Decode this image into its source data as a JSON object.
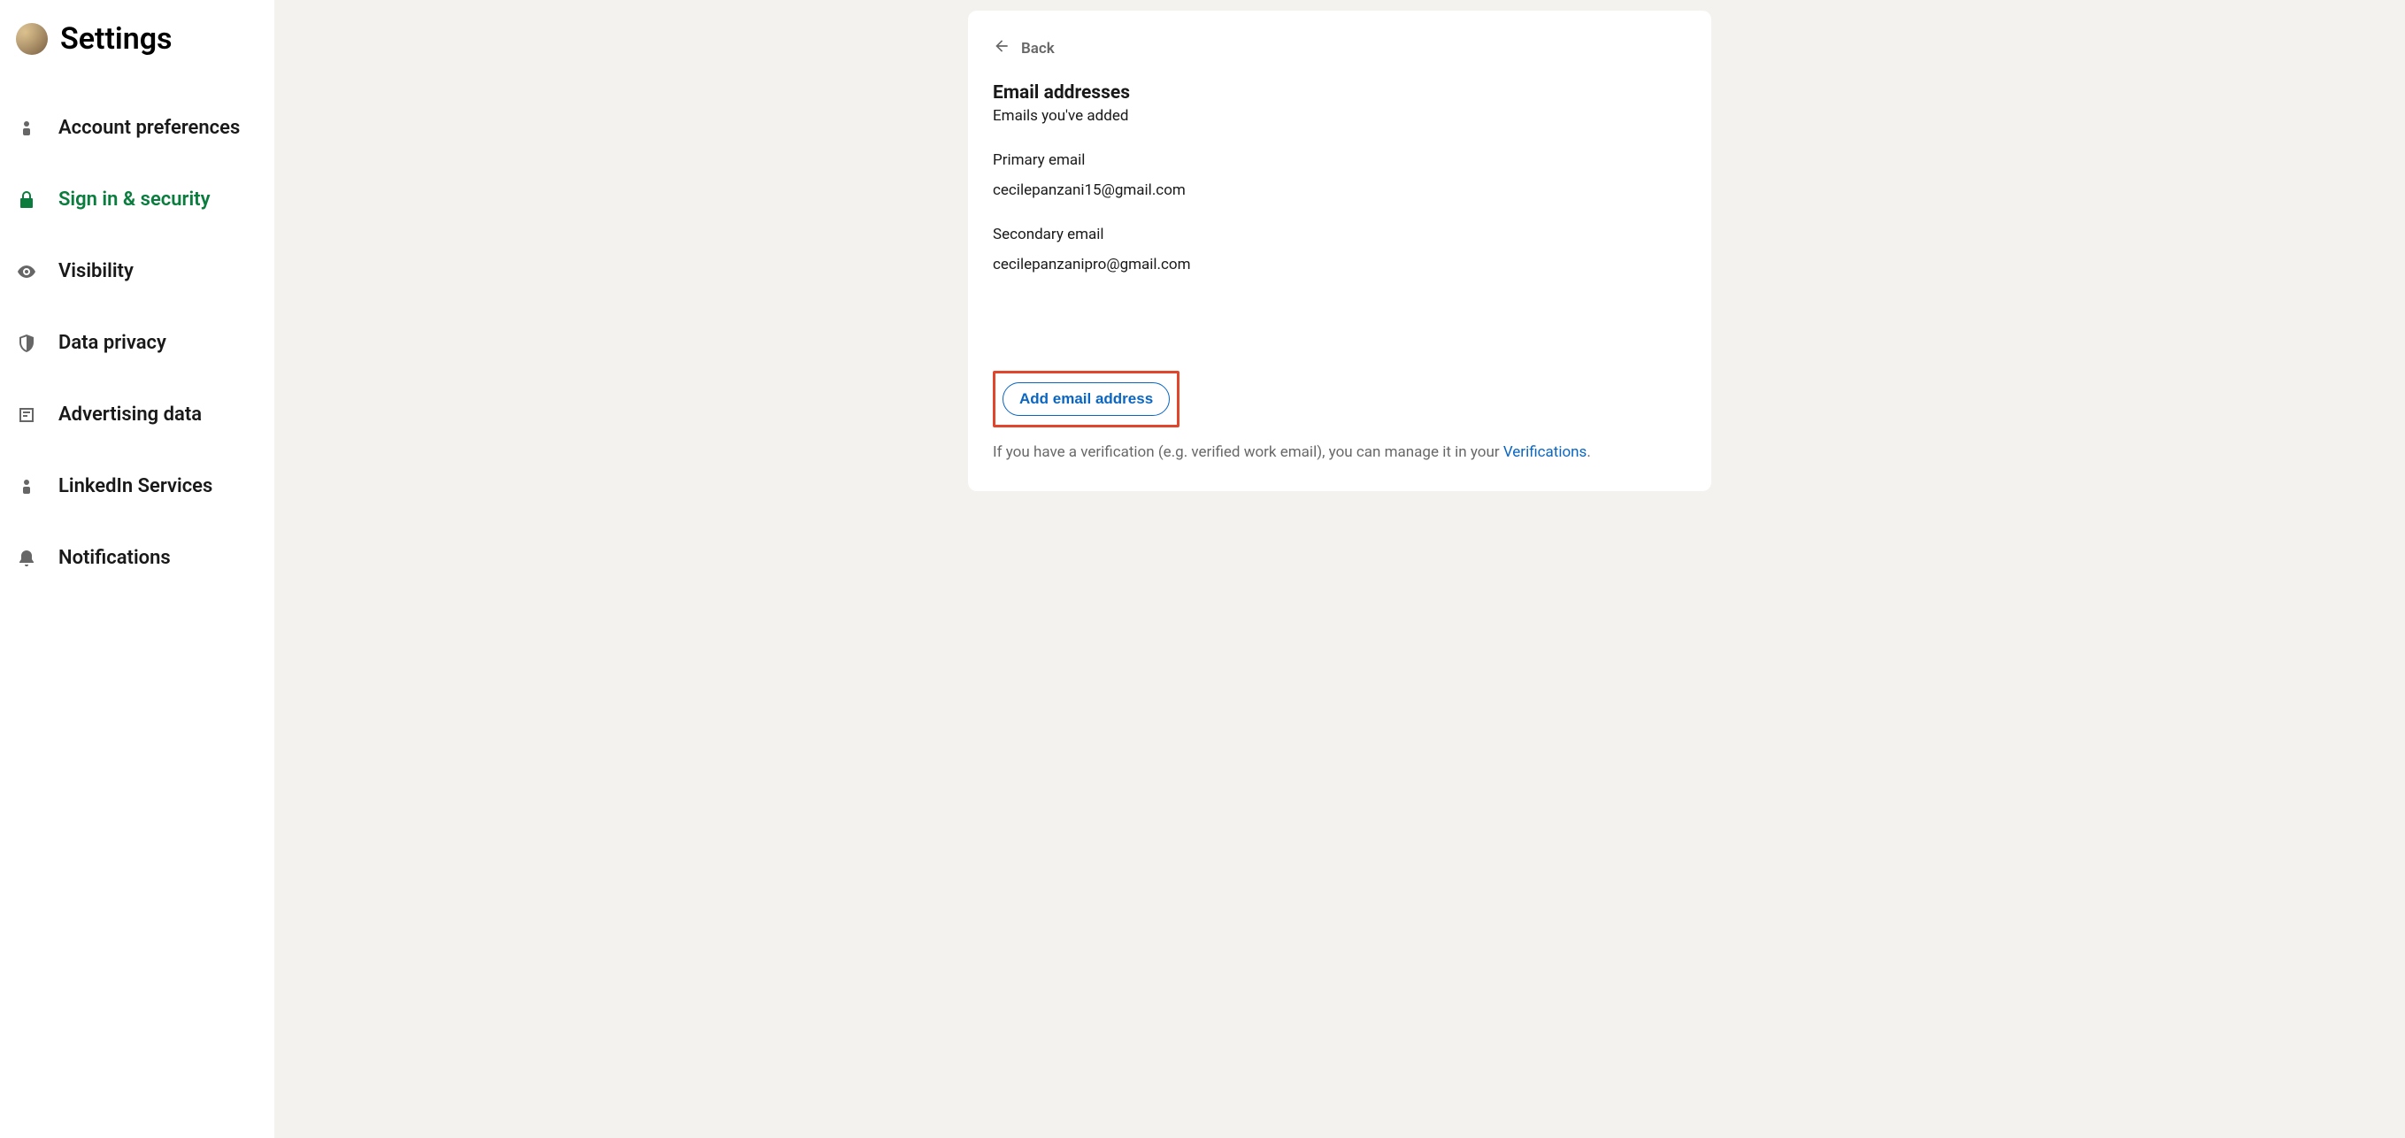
{
  "header": {
    "title": "Settings"
  },
  "sidebar": {
    "items": [
      {
        "label": "Account preferences"
      },
      {
        "label": "Sign in & security"
      },
      {
        "label": "Visibility"
      },
      {
        "label": "Data privacy"
      },
      {
        "label": "Advertising data"
      },
      {
        "label": "LinkedIn Services"
      },
      {
        "label": "Notifications"
      }
    ]
  },
  "main": {
    "back_label": "Back",
    "section_title": "Email addresses",
    "section_subtitle": "Emails you've added",
    "primary_label": "Primary email",
    "primary_value": "cecilepanzani15@gmail.com",
    "secondary_label": "Secondary email",
    "secondary_value": "cecilepanzanipro@gmail.com",
    "add_button": "Add email address",
    "footer_prefix": "If you have a verification (e.g. verified work email), you can manage it in your ",
    "footer_link": "Verifications",
    "footer_suffix": "."
  }
}
